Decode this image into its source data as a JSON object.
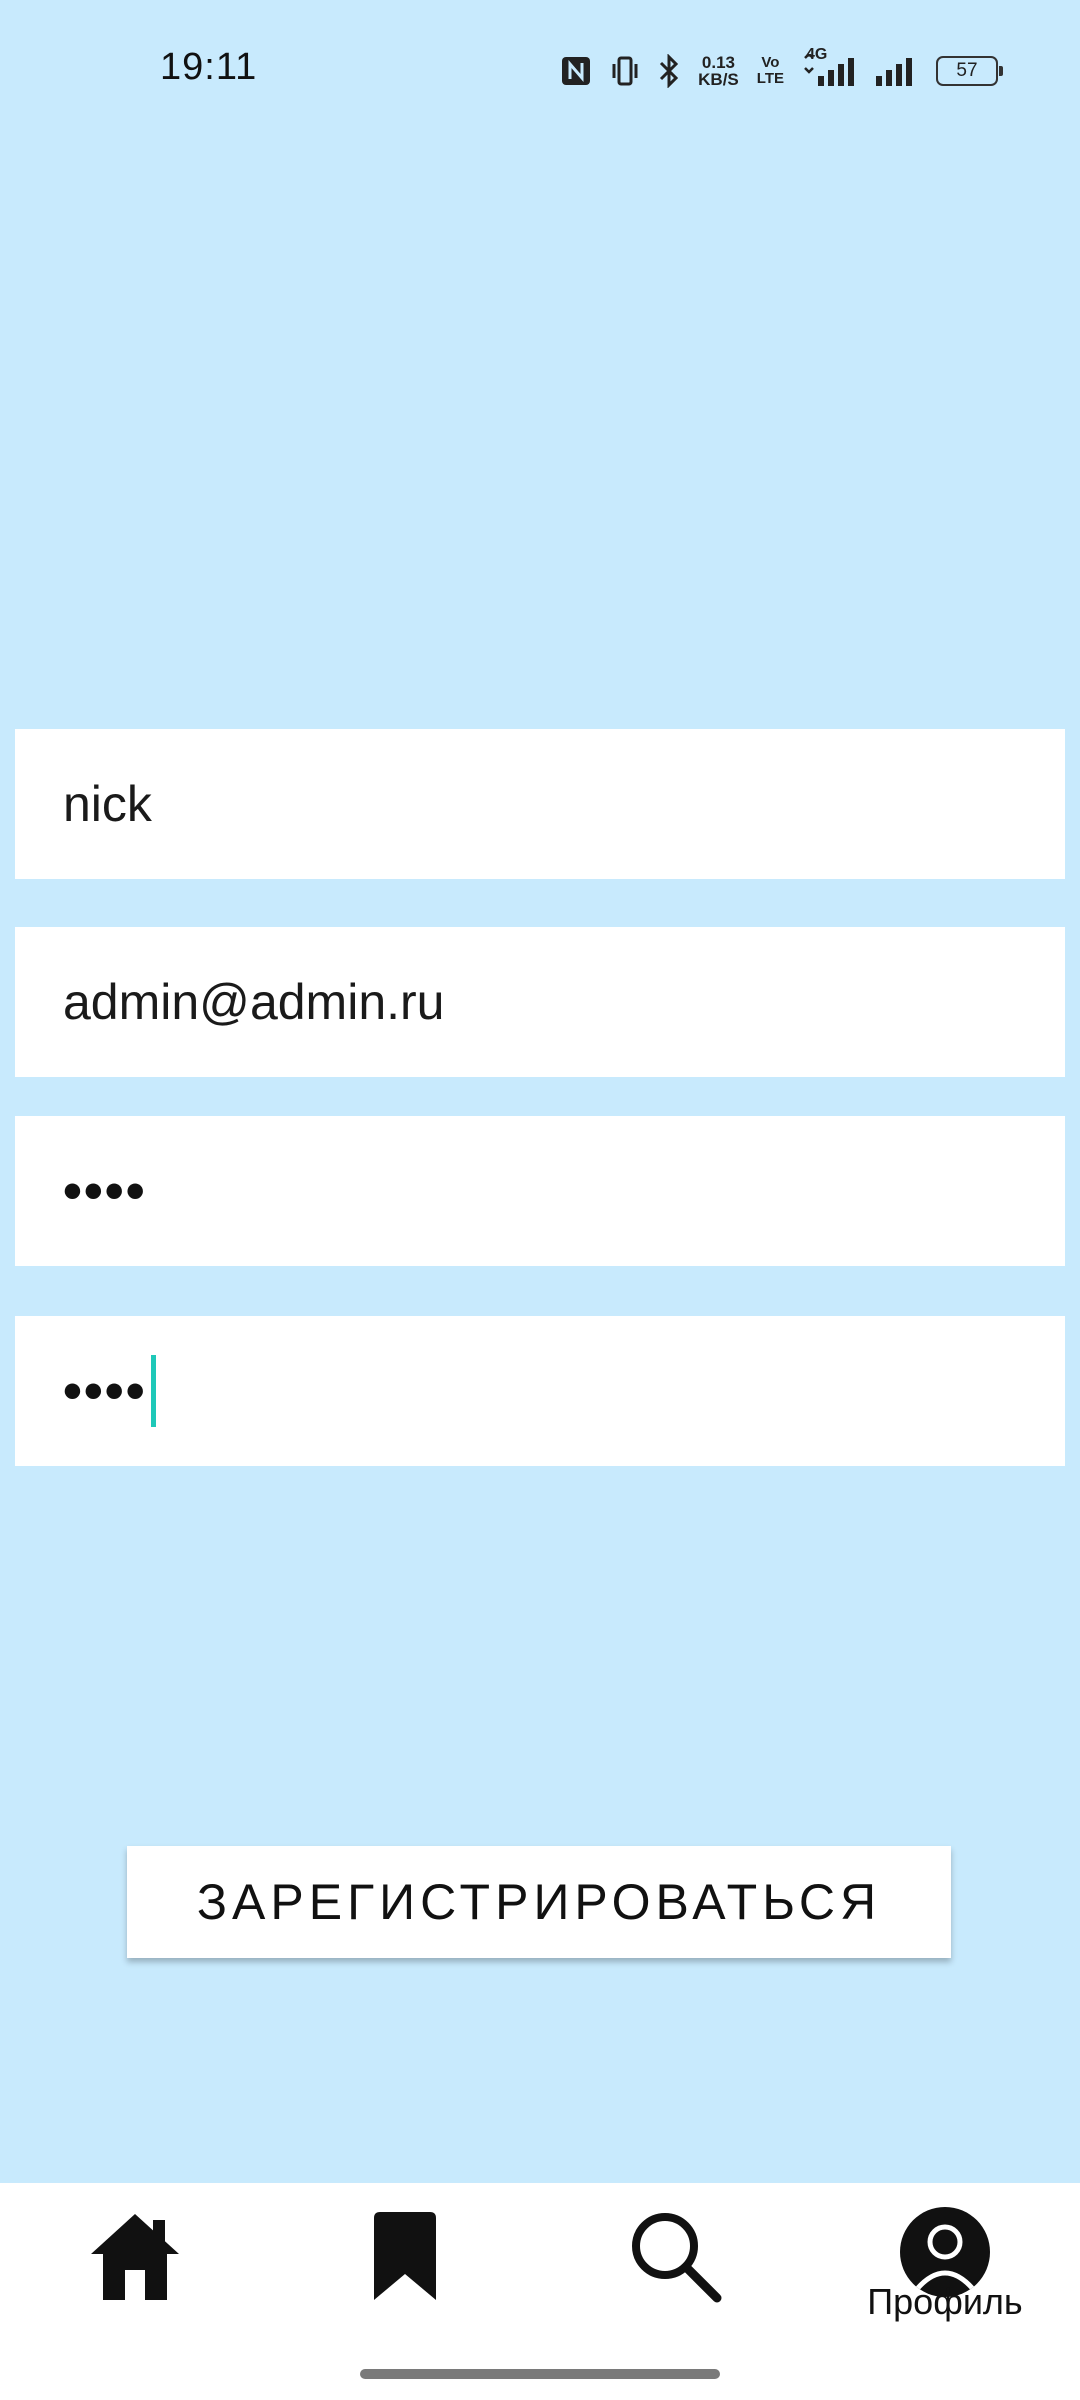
{
  "status_bar": {
    "time": "19:11",
    "net_speed_value": "0.13",
    "net_speed_unit": "KB/S",
    "volte_top": "Vo",
    "volte_bottom": "LTE",
    "network_type": "4G",
    "battery_level": "57",
    "icons": [
      "nfc-icon",
      "vibrate-icon",
      "bluetooth-icon",
      "signal-icon",
      "signal-icon",
      "battery-icon"
    ]
  },
  "form": {
    "nickname_value": "nick",
    "email_value": "admin@admin.ru",
    "password_value": "••••",
    "password_confirm_value": "••••",
    "register_label": "ЗАРЕГИСТРИРОВАТЬСЯ"
  },
  "bottom_nav": {
    "items": [
      {
        "icon": "home-icon",
        "label": ""
      },
      {
        "icon": "bookmark-icon",
        "label": ""
      },
      {
        "icon": "search-icon",
        "label": ""
      },
      {
        "icon": "profile-icon",
        "label": "Профиль"
      }
    ]
  },
  "colors": {
    "background": "#c8eafd",
    "field_background": "#ffffff",
    "cursor": "#1ec8b8",
    "nav_background": "#ffffff"
  }
}
